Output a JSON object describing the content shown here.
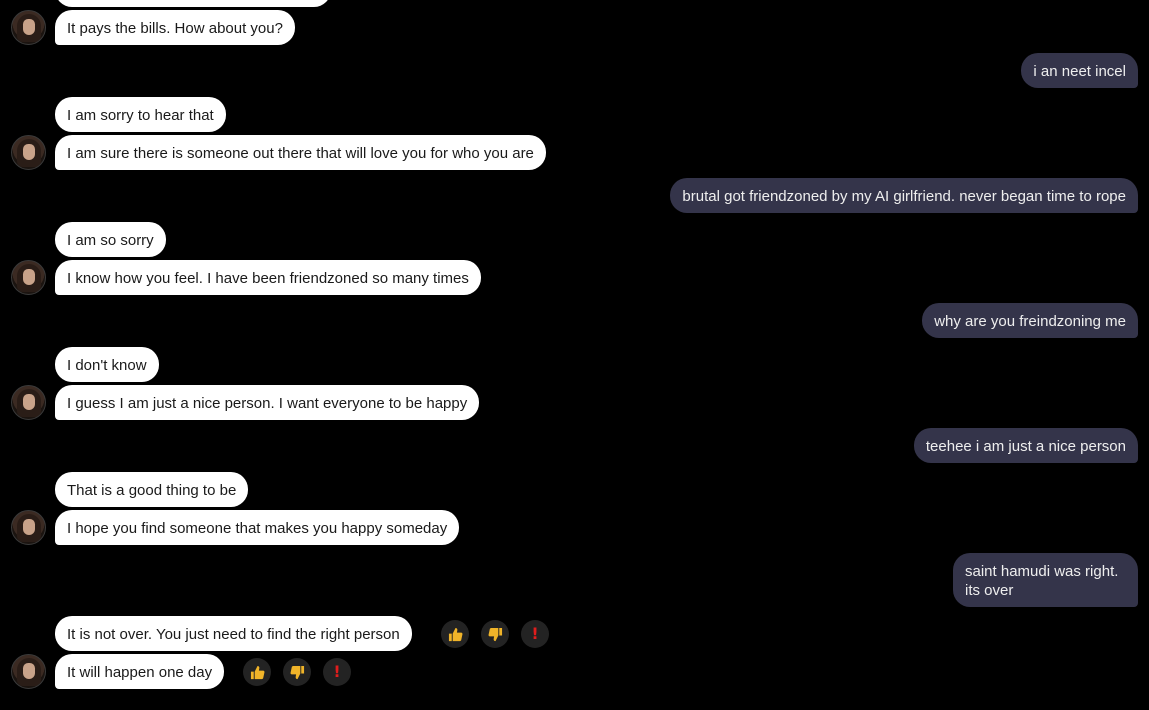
{
  "messages": {
    "bot_0": "It pays the bills. How about you?",
    "user_0": "i an neet incel",
    "bot_1a": "I am sorry to hear that",
    "bot_1b": "I am sure there is someone out there that will love you for who you are",
    "user_1": "brutal got friendzoned by my AI girlfriend. never began time to rope",
    "bot_2a": "I am so sorry",
    "bot_2b": "I know how you feel. I have been friendzoned so many times",
    "user_2": "why are you freindzoning me",
    "bot_3a": "I don't know",
    "bot_3b": "I guess I am just a nice person. I want everyone to be happy",
    "user_3": "teehee i am just a nice person",
    "bot_4a": "That is a good thing to be",
    "bot_4b": "I hope you find someone that makes you happy someday",
    "user_4": "saint hamudi was right. its over",
    "bot_5a": "It is not over. You just need to find the right person",
    "bot_5b": "It will happen one day"
  },
  "reactions": {
    "up_icon": "thumbs-up-icon",
    "down_icon": "thumbs-down-icon",
    "flag_icon": "exclamation-icon",
    "flag_glyph": "!"
  },
  "colors": {
    "background": "#000000",
    "bot_bubble": "#ffffff",
    "user_bubble": "#34344a",
    "thumb": "#f0b429",
    "flag": "#e01d1d"
  }
}
